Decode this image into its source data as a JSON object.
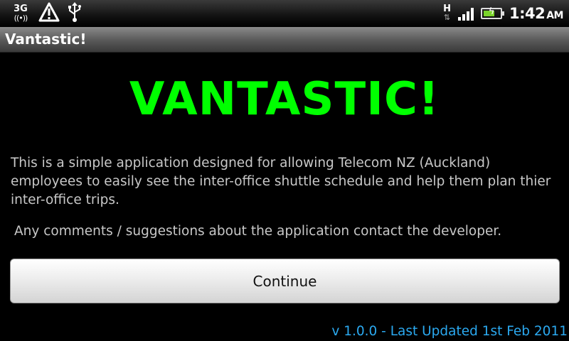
{
  "status_bar": {
    "network_type": "3G",
    "network_waves": "((•))",
    "hsdpa_label": "H",
    "hsdpa_arrows": "⇅",
    "time": "1:42",
    "ampm": "AM",
    "icons": [
      "3g-signal-icon",
      "warning-icon",
      "usb-icon",
      "hsdpa-icon",
      "signal-strength-icon",
      "battery-charging-icon"
    ],
    "signal_bars": 4,
    "battery_level": 0.7
  },
  "title_bar": {
    "title": "Vantastic!"
  },
  "main": {
    "headline": "VANTASTIC!",
    "description": "This is a simple application designed for allowing Telecom NZ (Auckland) employees to easily see the inter-office shuttle schedule and help them plan thier inter-office trips.",
    "comments": "Any comments / suggestions about the application contact the developer.",
    "continue_label": "Continue",
    "version_text": "v 1.0.0 - Last Updated 1st Feb 2011"
  },
  "colors": {
    "headline": "#00ff00",
    "version": "#2ba9f0",
    "background": "#000000"
  }
}
